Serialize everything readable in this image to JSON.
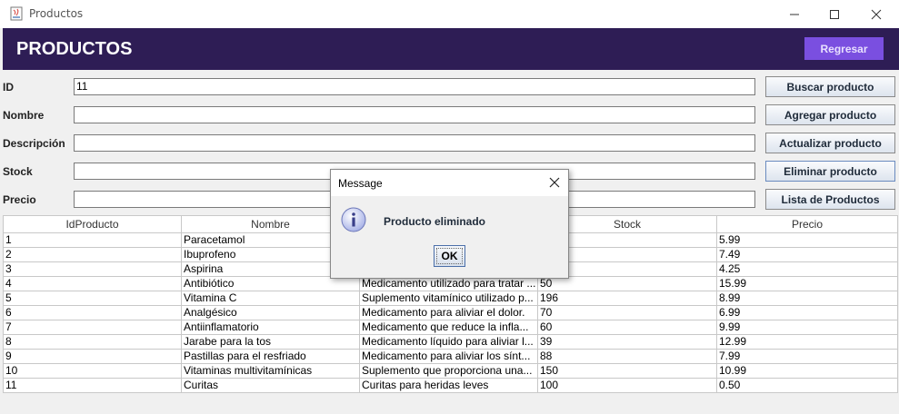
{
  "window": {
    "title": "Productos"
  },
  "header": {
    "title": "PRODUCTOS",
    "back_label": "Regresar"
  },
  "form": {
    "id_label": "ID",
    "id_value": "11",
    "nombre_label": "Nombre",
    "nombre_value": "",
    "descripcion_label": "Descripción",
    "descripcion_value": "",
    "stock_label": "Stock",
    "stock_value": "",
    "precio_label": "Precio",
    "precio_value": ""
  },
  "actions": {
    "buscar": "Buscar producto",
    "agregar": "Agregar producto",
    "actualizar": "Actualizar producto",
    "eliminar": "Eliminar producto",
    "lista": "Lista de Productos"
  },
  "table": {
    "columns": [
      "IdProducto",
      "Nombre",
      "",
      "Stock",
      "Precio"
    ],
    "rows": [
      [
        "1",
        "Paracetamol",
        "",
        "",
        "5.99"
      ],
      [
        "2",
        "Ibuprofeno",
        "",
        "",
        "7.49"
      ],
      [
        "3",
        "Aspirina",
        "",
        "",
        "4.25"
      ],
      [
        "4",
        "Antibiótico",
        "Medicamento utilizado para tratar ...",
        "50",
        "15.99"
      ],
      [
        "5",
        "Vitamina C",
        "Suplemento vitamínico utilizado p...",
        "196",
        "8.99"
      ],
      [
        "6",
        "Analgésico",
        "Medicamento para aliviar el dolor.",
        "70",
        "6.99"
      ],
      [
        "7",
        "Antiinflamatorio",
        "Medicamento que reduce la infla...",
        "60",
        "9.99"
      ],
      [
        "8",
        "Jarabe para la tos",
        "Medicamento líquido para aliviar l...",
        "39",
        "12.99"
      ],
      [
        "9",
        "Pastillas para el resfriado",
        "Medicamento para aliviar los sínt...",
        "88",
        "7.99"
      ],
      [
        "10",
        "Vitaminas multivitamínicas",
        "Suplemento que proporciona una...",
        "150",
        "10.99"
      ],
      [
        "11",
        "Curitas",
        "Curitas para heridas leves",
        "100",
        "0.50"
      ]
    ]
  },
  "dialog": {
    "title": "Message",
    "message": "Producto eliminado",
    "ok_label": "OK",
    "icon": "information-icon"
  },
  "colors": {
    "header_bg": "#2e1d55",
    "back_button_bg": "#7a4fe0"
  }
}
